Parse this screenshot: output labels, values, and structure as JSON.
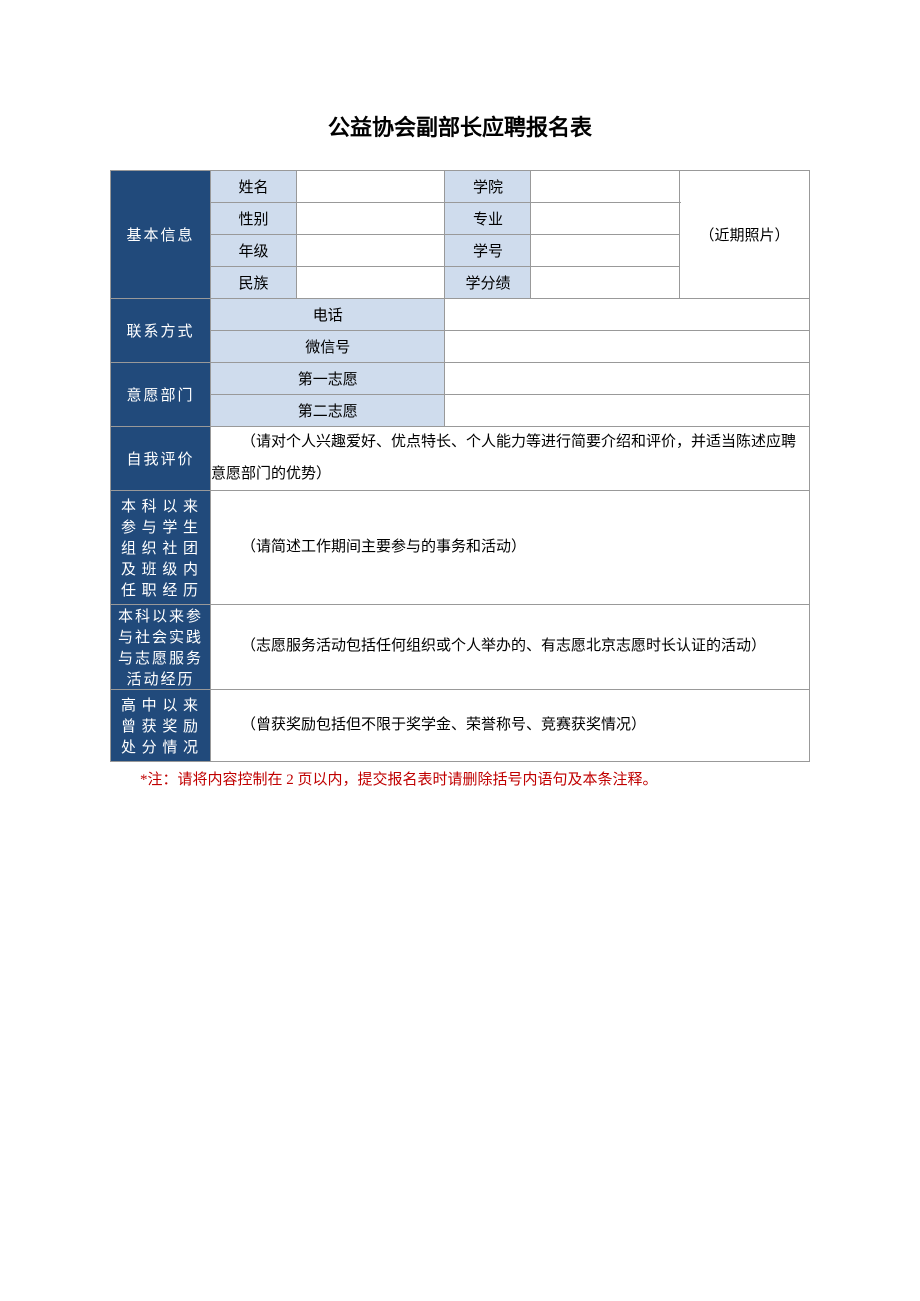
{
  "title": "公益协会副部长应聘报名表",
  "sections": {
    "basic": {
      "label": "基本信息",
      "fields": {
        "name": "姓名",
        "school": "学院",
        "gender": "性别",
        "major": "专业",
        "grade": "年级",
        "stuid": "学号",
        "ethnic": "民族",
        "gpa": "学分绩"
      },
      "photo": "（近期照片）"
    },
    "contact": {
      "label": "联系方式",
      "fields": {
        "phone": "电话",
        "wechat": "微信号"
      }
    },
    "preference": {
      "label": "意愿部门",
      "fields": {
        "first": "第一志愿",
        "second": "第二志愿"
      }
    },
    "selfeval": {
      "label": "自我评价",
      "prompt": "（请对个人兴趣爱好、优点特长、个人能力等进行简要介绍和评价，并适当陈述应聘意愿部门的优势）"
    },
    "orgexp": {
      "label": "本科以来参与学生组织社团及班级内任职经历",
      "prompt": "（请简述工作期间主要参与的事务和活动）"
    },
    "volexp": {
      "label": "本科以来参与社会实践与志愿服务活动经历",
      "prompt": "（志愿服务活动包括任何组织或个人举办的、有志愿北京志愿时长认证的活动）"
    },
    "awards": {
      "label": "高中以来曾获奖励处分情况",
      "prompt": "（曾获奖励包括但不限于奖学金、荣誉称号、竞赛获奖情况）"
    }
  },
  "note": "*注：请将内容控制在 2 页以内，提交报名表时请删除括号内语句及本条注释。"
}
